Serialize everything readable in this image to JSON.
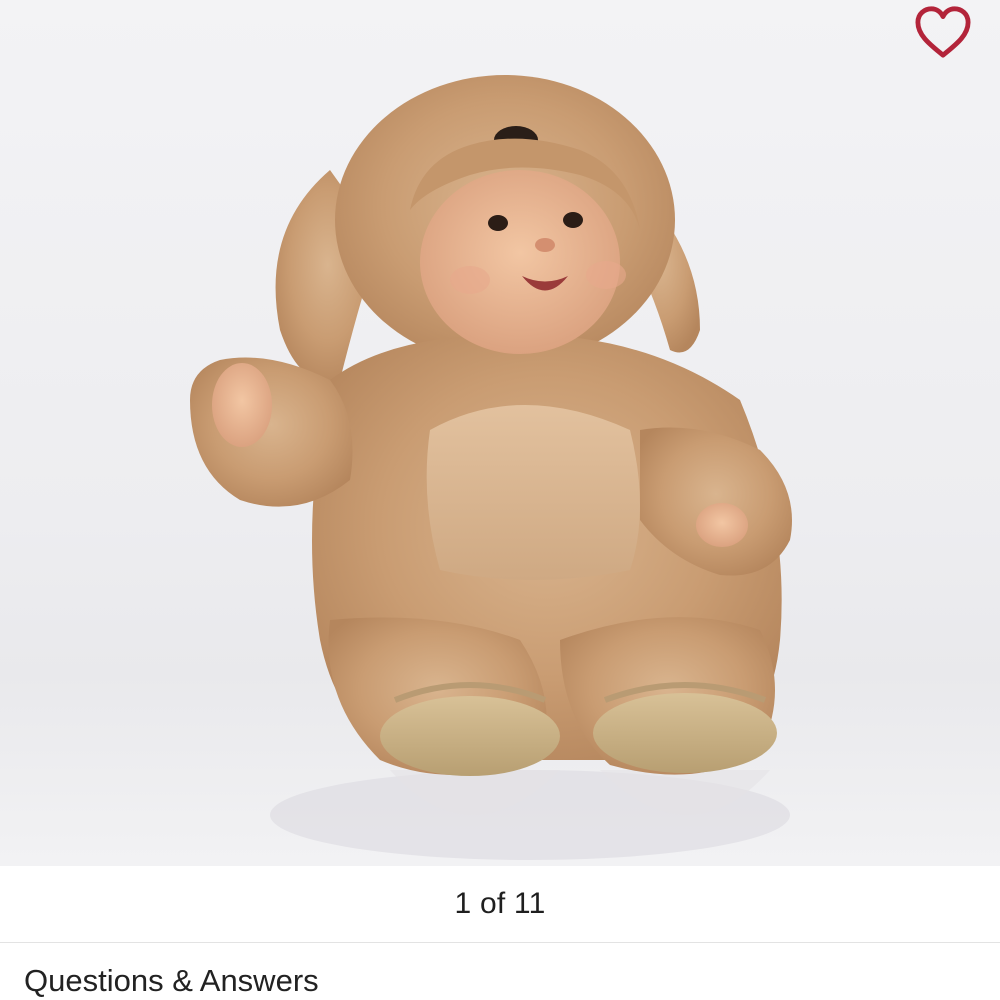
{
  "product_gallery": {
    "image_description_icon": "baby-in-plush-puppy-costume-photo",
    "favorite_icon": "heart-outline-icon",
    "favorite_color": "#b3243a",
    "pager_text": "1 of 11"
  },
  "sections": {
    "qa_heading": "Questions & Answers"
  }
}
